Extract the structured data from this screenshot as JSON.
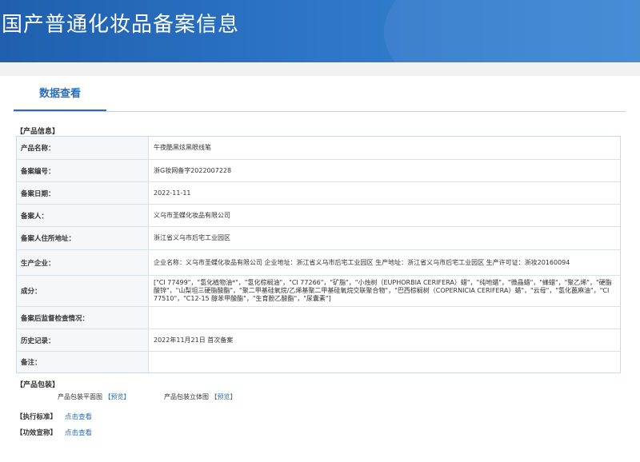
{
  "header": {
    "title": "国产普通化妆品备案信息"
  },
  "tabs": [
    {
      "label": "数据查看"
    }
  ],
  "product_info": {
    "section_title": "【产品信息】",
    "rows": [
      {
        "label": "产品名称：",
        "value": "午夜酷黑炫黑眼线笔"
      },
      {
        "label": "备案编号：",
        "value": "浙G妆网备字2022007228"
      },
      {
        "label": "备案日期：",
        "value": "2022-11-11"
      },
      {
        "label": "备案人：",
        "value": "义乌市圣蝶化妆品有限公司"
      },
      {
        "label": "备案人住所地址：",
        "value": "浙江省义乌市后宅工业园区"
      },
      {
        "label": "生产企业：",
        "value": "企业名称：义乌市圣蝶化妆品有限公司 企业地址：浙江省义乌市后宅工业园区 生产地址：浙江省义乌市后宅工业园区 生产许可证：浙妆20160094"
      },
      {
        "label": "成分：",
        "value": "[\"CI 77499\"，\"氢化植物油*\"，\"氢化棕榈油\"，\"CI 77266\"，\"矿脂\"，\"小烛树（EUPHORBIA CERIFERA）蜡\"，\"纯地蜡\"，\"微晶蜡\"，\"蜂蜡\"，\"聚乙烯\"，\"硬脂酸锌\"，\"山梨坦三硬脂酸酯\"，\"聚二甲基硅氧烷/乙烯基聚二甲基硅氧烷交联聚合物\"，\"巴西棕榈树（COPERNICIA CERIFERA）蜡\"，\"云母\"，\"氢化蓖麻油\"，\"CI 77510\"，\"C12-15 醇苯甲酸酯\"，\"生育酚乙酸酯\"，\"尿囊素\"]"
      },
      {
        "label": "备案后监督检查情况：",
        "value": ""
      },
      {
        "label": "历史记录：",
        "value": "2022年11月21日 首次备案"
      },
      {
        "label": "备注：",
        "value": ""
      }
    ]
  },
  "packaging": {
    "section_title": "【产品包装】",
    "items": [
      {
        "label": "产品包装平面图",
        "link": "【预览】"
      },
      {
        "label": "产品包装立体图",
        "link": "【预览】"
      }
    ]
  },
  "standards": {
    "title": "【执行标准】",
    "link": "点击查看"
  },
  "claims": {
    "title": "【功效宣称】",
    "link": "点击查看"
  }
}
